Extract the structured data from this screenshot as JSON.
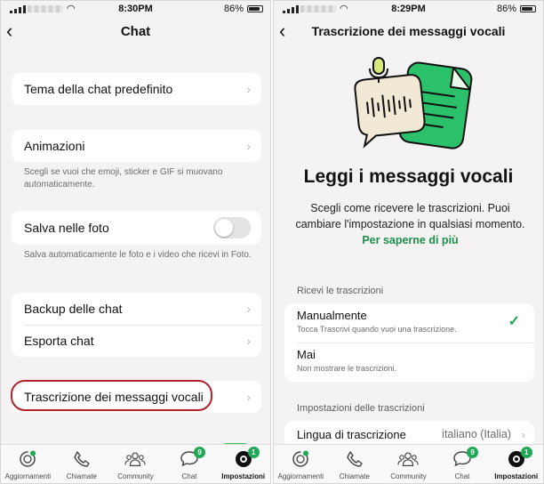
{
  "left": {
    "status": {
      "time": "8:30PM",
      "battery": "86%"
    },
    "nav": {
      "title": "Chat"
    },
    "rows": {
      "tema": "Tema della chat predefinito",
      "animazioni": "Animazioni",
      "animazioni_help": "Scegli se vuoi che emoji, sticker e GIF si muovano automaticamente.",
      "salva": "Salva nelle foto",
      "salva_help": "Salva automaticamente le foto e i video che ricevi in Foto.",
      "backup": "Backup delle chat",
      "esporta": "Esporta chat",
      "trascrizione": "Trascrizione dei messaggi vocali"
    },
    "salva_toggle_on": false
  },
  "right": {
    "status": {
      "time": "8:29PM",
      "battery": "86%"
    },
    "nav": {
      "title": "Trascrizione dei messaggi vocali"
    },
    "headline": "Leggi i messaggi vocali",
    "intro": "Scegli come ricevere le trascrizioni. Puoi cambiare l'impostazione in qualsiasi momento.",
    "intro_link": "Per saperne di più",
    "section_receive": "Ricevi le trascrizioni",
    "options": [
      {
        "title": "Manualmente",
        "subtitle": "Tocca Trascrivi quando vuoi una trascrizione.",
        "selected": true
      },
      {
        "title": "Mai",
        "subtitle": "Non mostrare le trascrizioni.",
        "selected": false
      }
    ],
    "section_settings": "Impostazioni delle trascrizioni",
    "language_label": "Lingua di trascrizione",
    "language_value": "italiano (Italia)"
  },
  "tabs": {
    "aggiornamenti": "Aggiornamenti",
    "chiamate": "Chiamate",
    "community": "Community",
    "chat": "Chat",
    "chat_badge": "9",
    "impostazioni": "Impostazioni",
    "impostazioni_badge": "1"
  },
  "colors": {
    "accent": "#1fa855",
    "highlight": "#b2222a",
    "link": "#1d8f4a"
  }
}
